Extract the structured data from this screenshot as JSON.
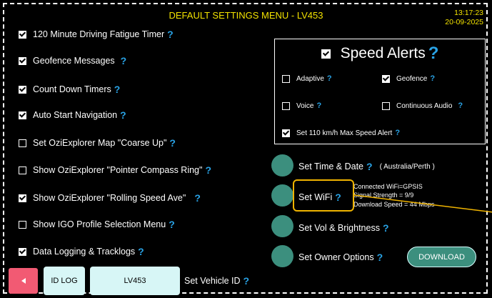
{
  "header": {
    "title": "DEFAULT SETTINGS MENU - LV453",
    "time": "13:17:23",
    "date": "20-09-2025"
  },
  "settings": [
    {
      "label": "120 Minute Driving Fatigue Timer",
      "checked": true
    },
    {
      "label": "Geofence Messages",
      "checked": true
    },
    {
      "label": "Count Down Timers",
      "checked": true
    },
    {
      "label": "Auto Start Navigation",
      "checked": true
    },
    {
      "label": "Set OziExplorer Map \"Coarse Up\"",
      "checked": false
    },
    {
      "label": "Show OziExplorer \"Pointer Compass Ring\"",
      "checked": false
    },
    {
      "label": "Show OziExplorer \"Rolling Speed Ave\"",
      "checked": true
    },
    {
      "label": "Show IGO Profile Selection Menu",
      "checked": false
    },
    {
      "label": "Data Logging & Tracklogs",
      "checked": true
    }
  ],
  "help_glyph": "?",
  "speed_alerts": {
    "title": "Speed Alerts",
    "checked": true,
    "options": [
      {
        "label": "Adaptive",
        "checked": false
      },
      {
        "label": "Geofence",
        "checked": true
      },
      {
        "label": "Voice",
        "checked": false
      },
      {
        "label": "Continuous Audio",
        "checked": false
      },
      {
        "label": "Set 110 km/h Max Speed Alert",
        "checked": true
      }
    ]
  },
  "actions": {
    "time_date": {
      "label": "Set Time & Date",
      "extra": "( Australia/Perth )"
    },
    "wifi": {
      "label": "Set WiFi",
      "connected": "Connected WiFi=GPSIS",
      "strength": "Signal Strength = 9/9",
      "speed": "Download Speed = 44 Mbps"
    },
    "vol": {
      "label": "Set Vol & Brightness"
    },
    "owner": {
      "label": "Set Owner Options"
    },
    "download": "DOWNLOAD"
  },
  "footer": {
    "id_log": "ID LOG",
    "vehicle": "LV453",
    "set_vehicle": "Set Vehicle ID"
  },
  "colors": {
    "accent_yellow": "#f2e200",
    "help_blue": "#29a3e6",
    "button_teal": "#3c8f7e",
    "highlight": "#f0b400",
    "back_pink": "#f25a73"
  }
}
